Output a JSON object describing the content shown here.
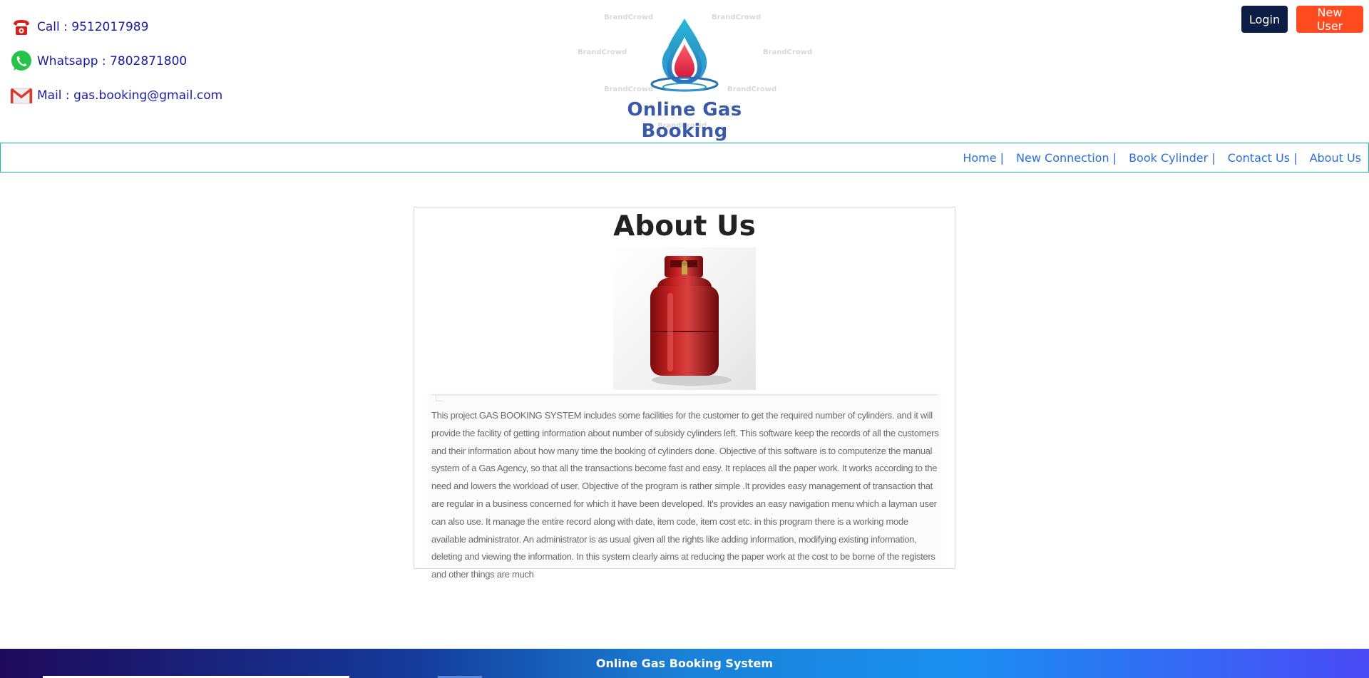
{
  "contacts": {
    "call": "Call : 9512017989",
    "whatsapp": "Whatsapp : 7802871800",
    "mail": "Mail : gas.booking@gmail.com"
  },
  "logo": {
    "title": "Online Gas Booking",
    "watermark": "BrandCrowd"
  },
  "auth": {
    "login_label": "Login",
    "new_user_label": "New User"
  },
  "nav": {
    "items": [
      {
        "label": "Home |"
      },
      {
        "label": "New Connection |"
      },
      {
        "label": "Book Cylinder |"
      },
      {
        "label": "Contact Us |"
      },
      {
        "label": "About Us"
      }
    ]
  },
  "main": {
    "title": "About Us",
    "description": "This project GAS BOOKING SYSTEM includes some facilities for the customer to get the required number of cylinders. and it will provide the facility of getting information about number of subsidy cylinders left. This software keep the records of all the customers and their information about how many time the booking of cylinders done. Objective of this software is to computerize the manual system of a Gas Agency, so that all the transactions become fast and easy. It replaces all the paper work. It works according to the need and lowers the workload of user. Objective of the program is rather simple .It provides easy management of transaction that are regular in a business concerned for which it have been developed. It's provides an easy navigation menu which a layman user can also use. It manage the entire record along with date, item code, item cost etc. in this program there is a working mode available administrator. An administrator is as usual given all the rights like adding information, modifying existing information, deleting and viewing the information. In this system clearly aims at reducing the paper work at the cost to be borne of the registers and other things are much"
  },
  "footer": {
    "text": "Online Gas Booking System"
  },
  "colors": {
    "contact_text": "#1a1aa6",
    "nav_link": "#2a6fe0",
    "nav_border": "#22b6b0",
    "login_bg": "#0c1e45",
    "new_user_bg": "#ff4b1f",
    "logo_title": "#3a5aa8",
    "cylinder_red": "#b81c1c"
  },
  "icons": {
    "call": "telephone-icon",
    "whatsapp": "whatsapp-icon",
    "mail": "mail-icon"
  }
}
